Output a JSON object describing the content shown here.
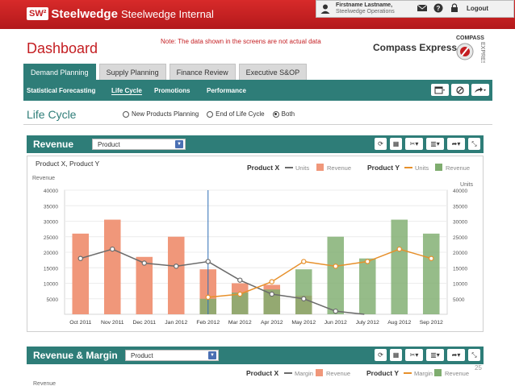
{
  "header": {
    "badge": "SW²",
    "brand": "Steelwedge",
    "app_name": "Steelwedge Internal",
    "user_name": "Firstname Lastname,",
    "user_org": "Steelwedge Operations",
    "logout": "Logout"
  },
  "page": {
    "title": "Dashboard",
    "note": "Note: The data shown in the screens are not actual data",
    "product": "Compass Express",
    "logo_text": "COMPASS EXPRESS"
  },
  "tabs": [
    {
      "label": "Demand Planning",
      "active": true
    },
    {
      "label": "Supply Planning",
      "active": false
    },
    {
      "label": "Finance Review",
      "active": false
    },
    {
      "label": "Executive S&OP",
      "active": false
    }
  ],
  "subnav": [
    {
      "label": "Statistical Forecasting"
    },
    {
      "label": "Life Cycle"
    },
    {
      "label": "Promotions"
    },
    {
      "label": "Performance"
    }
  ],
  "life_cycle": {
    "title": "Life Cycle",
    "options": [
      {
        "label": "New Products Planning",
        "selected": false
      },
      {
        "label": "End of Life Cycle",
        "selected": false
      },
      {
        "label": "Both",
        "selected": true
      }
    ]
  },
  "revenue_panel": {
    "title": "Revenue",
    "select": "Product"
  },
  "margin_panel": {
    "title": "Revenue & Margin",
    "select": "Product",
    "legend": {
      "group_x": "Product X",
      "group_y": "Product Y",
      "line_label": "Margin",
      "bar_label": "Revenue"
    },
    "y_axis_title": "Revenue"
  },
  "page_number": "25",
  "chart_data": {
    "type": "bar",
    "title": "Product X, Product Y",
    "ylabel": "Revenue",
    "y2label": "Units",
    "categories": [
      "Oct 2011",
      "Nov 2011",
      "Dec 2011",
      "Jan 2012",
      "Feb 2012",
      "Mar 2012",
      "Apr 2012",
      "May 2012",
      "Jun 2012",
      "July 2012",
      "Aug 2012",
      "Sep 2012"
    ],
    "ylim": [
      0,
      40000
    ],
    "yticks": [
      5000,
      10000,
      15000,
      20000,
      25000,
      30000,
      35000,
      40000
    ],
    "legend": {
      "group_x": "Product X",
      "group_y": "Product Y",
      "line_label": "Units",
      "bar_label": "Revenue"
    },
    "colors": {
      "x_bar": "#f0977a",
      "y_bar": "#7fad6f",
      "x_line": "#6b6b6b",
      "y_line": "#e7902b",
      "marker": "#2e6fb5"
    },
    "marker_category": "Feb 2012",
    "series": [
      {
        "name": "Product X",
        "kind": "bar",
        "values": [
          26000,
          30500,
          18500,
          25000,
          14500,
          10000,
          9500,
          6000,
          null,
          null,
          null,
          null
        ]
      },
      {
        "name": "Product Y",
        "kind": "bar",
        "values": [
          null,
          null,
          null,
          null,
          5000,
          7000,
          8000,
          14500,
          25000,
          18000,
          30500,
          26000
        ]
      },
      {
        "name": "Product X",
        "kind": "line",
        "values": [
          18000,
          21000,
          16500,
          15500,
          17000,
          11000,
          6500,
          5000,
          1000,
          -500,
          null,
          null
        ]
      },
      {
        "name": "Product Y",
        "kind": "line",
        "values": [
          null,
          null,
          null,
          null,
          5500,
          6500,
          10500,
          17000,
          15500,
          17000,
          21000,
          18000
        ]
      }
    ]
  }
}
